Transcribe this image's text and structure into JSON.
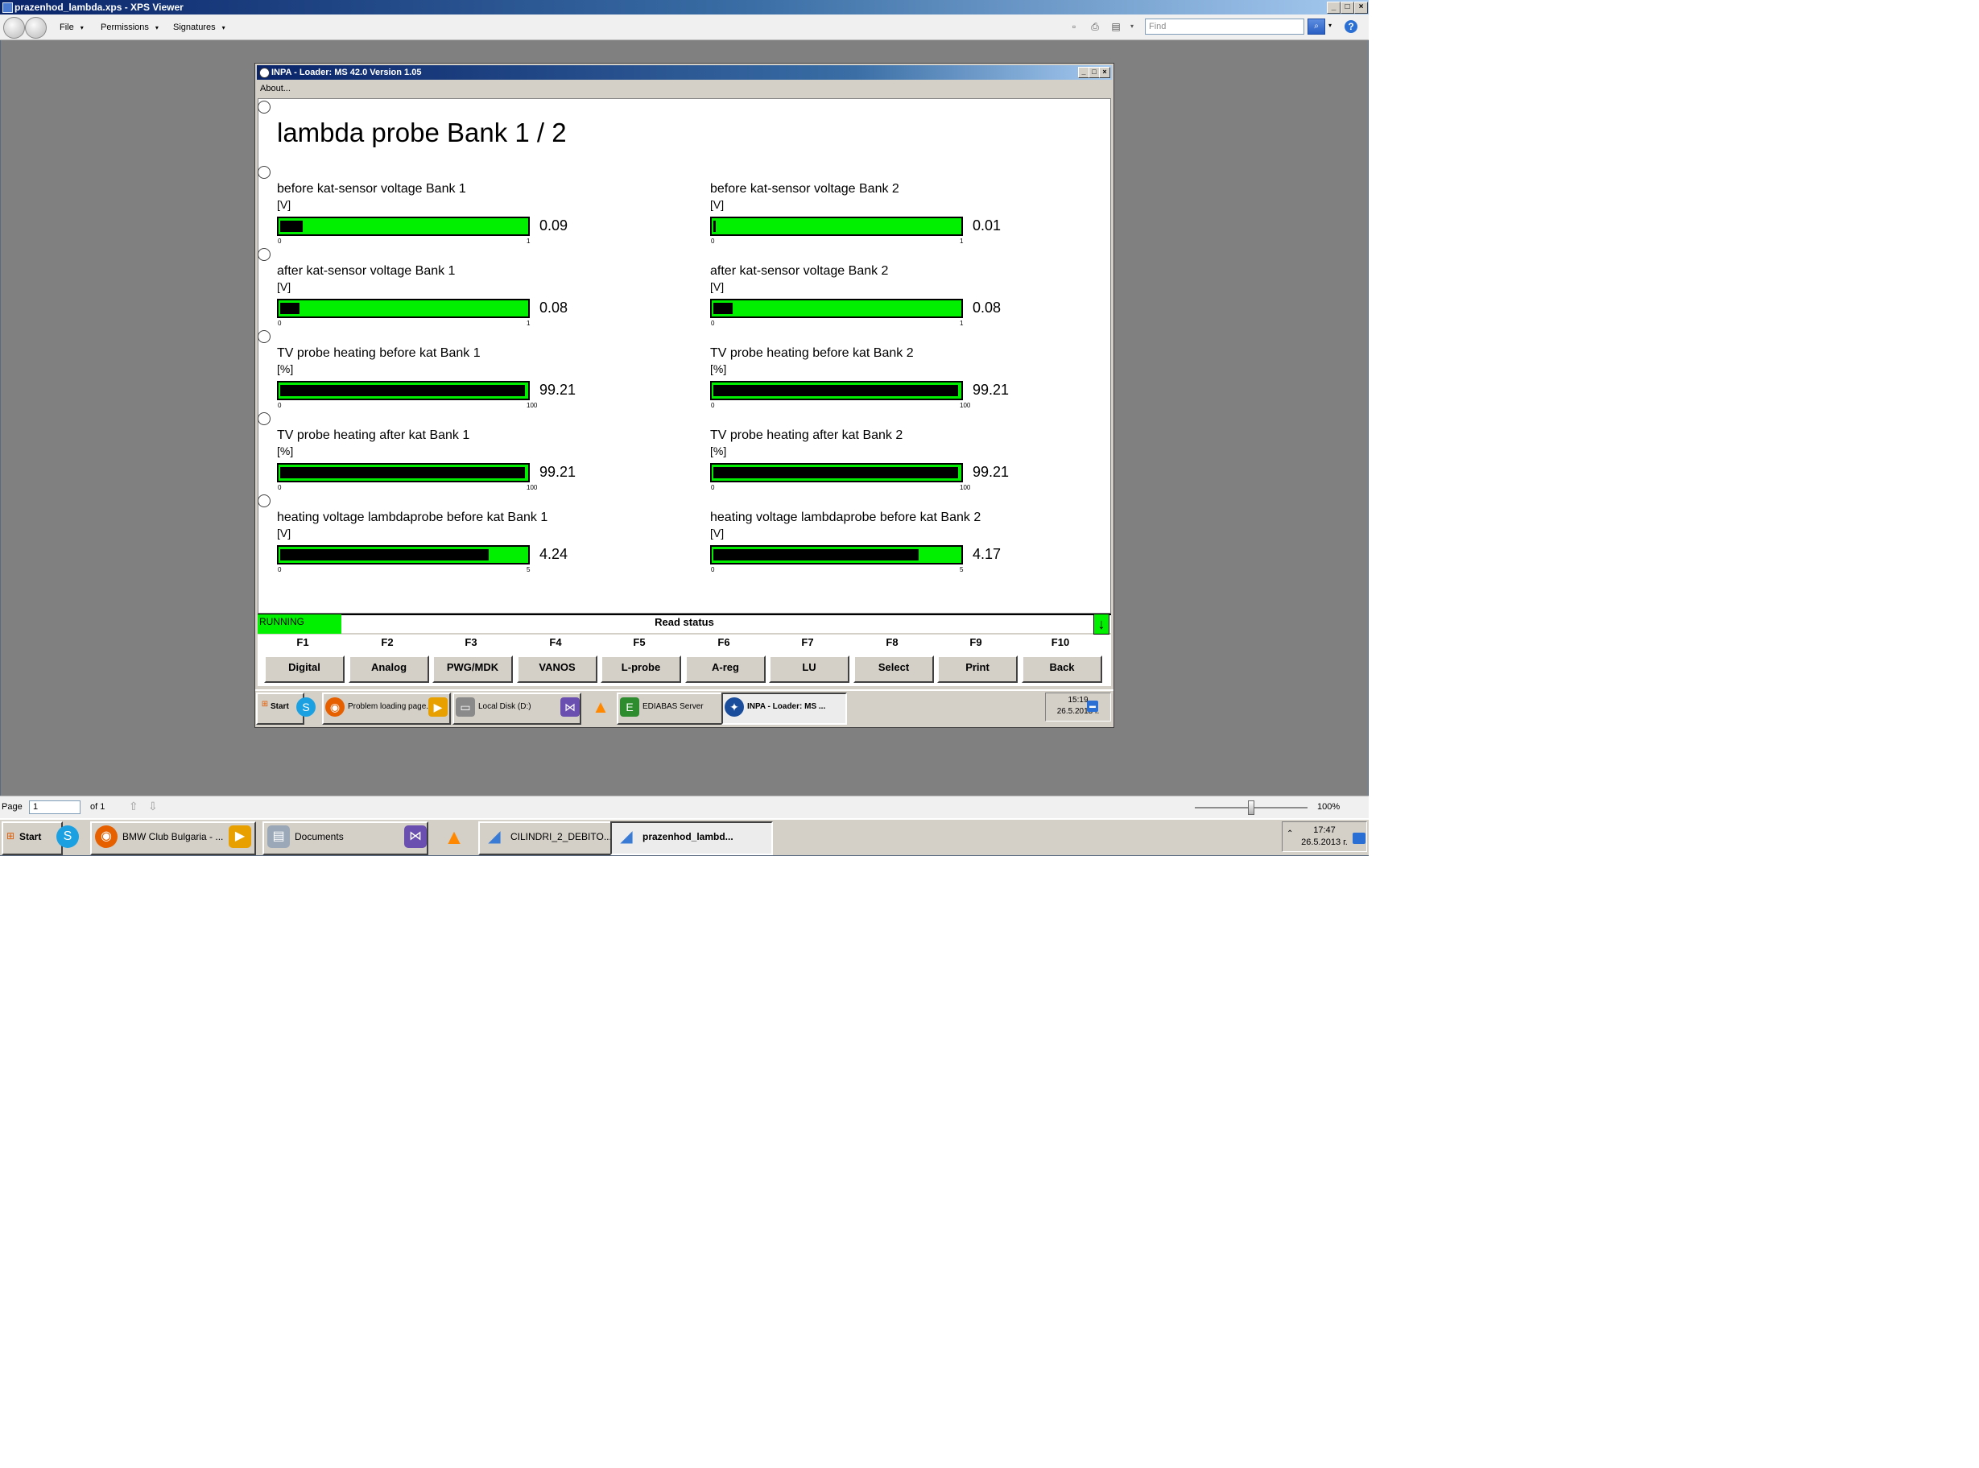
{
  "xps": {
    "title": "prazenhod_lambda.xps - XPS Viewer",
    "menus": [
      "File",
      "Permissions",
      "Signatures"
    ],
    "find_placeholder": "Find",
    "page_label": "Page",
    "page_value": "1",
    "page_of": "of 1",
    "zoom": "100%"
  },
  "inpa": {
    "title": "INPA - Loader: MS 42.0 Version 1.05",
    "menu_about": "About...",
    "heading": "lambda probe Bank 1 / 2",
    "indicators": [
      {
        "label": "before kat-sensor voltage Bank 1",
        "unit": "[V]",
        "value": "0.09",
        "min": "0",
        "max": "1",
        "fill": 0.09
      },
      {
        "label": "before kat-sensor voltage Bank 2",
        "unit": "[V]",
        "value": "0.01",
        "min": "0",
        "max": "1",
        "fill": 0.01
      },
      {
        "label": "after kat-sensor voltage Bank 1",
        "unit": "[V]",
        "value": "0.08",
        "min": "0",
        "max": "1",
        "fill": 0.08
      },
      {
        "label": "after kat-sensor voltage Bank 2",
        "unit": "[V]",
        "value": "0.08",
        "min": "0",
        "max": "1",
        "fill": 0.08
      },
      {
        "label": "TV probe heating before kat Bank 1",
        "unit": "[%]",
        "value": "99.21",
        "min": "0",
        "max": "100",
        "fill": 0.9921
      },
      {
        "label": "TV probe heating before kat Bank 2",
        "unit": "[%]",
        "value": "99.21",
        "min": "0",
        "max": "100",
        "fill": 0.9921
      },
      {
        "label": "TV probe heating after kat Bank 1",
        "unit": "[%]",
        "value": "99.21",
        "min": "0",
        "max": "100",
        "fill": 0.9921
      },
      {
        "label": "TV probe heating after kat Bank 2",
        "unit": "[%]",
        "value": "99.21",
        "min": "0",
        "max": "100",
        "fill": 0.9921
      },
      {
        "label": "heating voltage lambdaprobe before kat Bank 1",
        "unit": "[V]",
        "value": "4.24",
        "min": "0",
        "max": "5",
        "fill": 0.848
      },
      {
        "label": "heating voltage lambdaprobe before kat Bank 2",
        "unit": "[V]",
        "value": "4.17",
        "min": "0",
        "max": "5",
        "fill": 0.834
      }
    ],
    "status": "RUNNING",
    "status_text": "Read status",
    "fkeys": [
      {
        "key": "F1",
        "label": "Digital"
      },
      {
        "key": "F2",
        "label": "Analog"
      },
      {
        "key": "F3",
        "label": "PWG/MDK"
      },
      {
        "key": "F4",
        "label": "VANOS"
      },
      {
        "key": "F5",
        "label": "L-probe"
      },
      {
        "key": "F6",
        "label": "A-reg"
      },
      {
        "key": "F7",
        "label": "LU"
      },
      {
        "key": "F8",
        "label": "Select"
      },
      {
        "key": "F9",
        "label": "Print"
      },
      {
        "key": "F10",
        "label": "Back"
      }
    ]
  },
  "inner_taskbar": {
    "start": "Start",
    "items": [
      "Problem loading page...",
      "Local Disk (D:)",
      "EDIABAS Server",
      "INPA - Loader: MS ..."
    ],
    "time": "15:19",
    "date": "26.5.2013 г."
  },
  "outer_taskbar": {
    "start": "Start",
    "items": [
      "BMW Club Bulgaria - ...",
      "Documents",
      "CILINDRI_2_DEBITO...",
      "prazenhod_lambd..."
    ],
    "time": "17:47",
    "date": "26.5.2013 г."
  },
  "colors": {
    "gauge": "#00f000",
    "gauge_fill": "#000000",
    "titlebar": "#0a246a"
  }
}
